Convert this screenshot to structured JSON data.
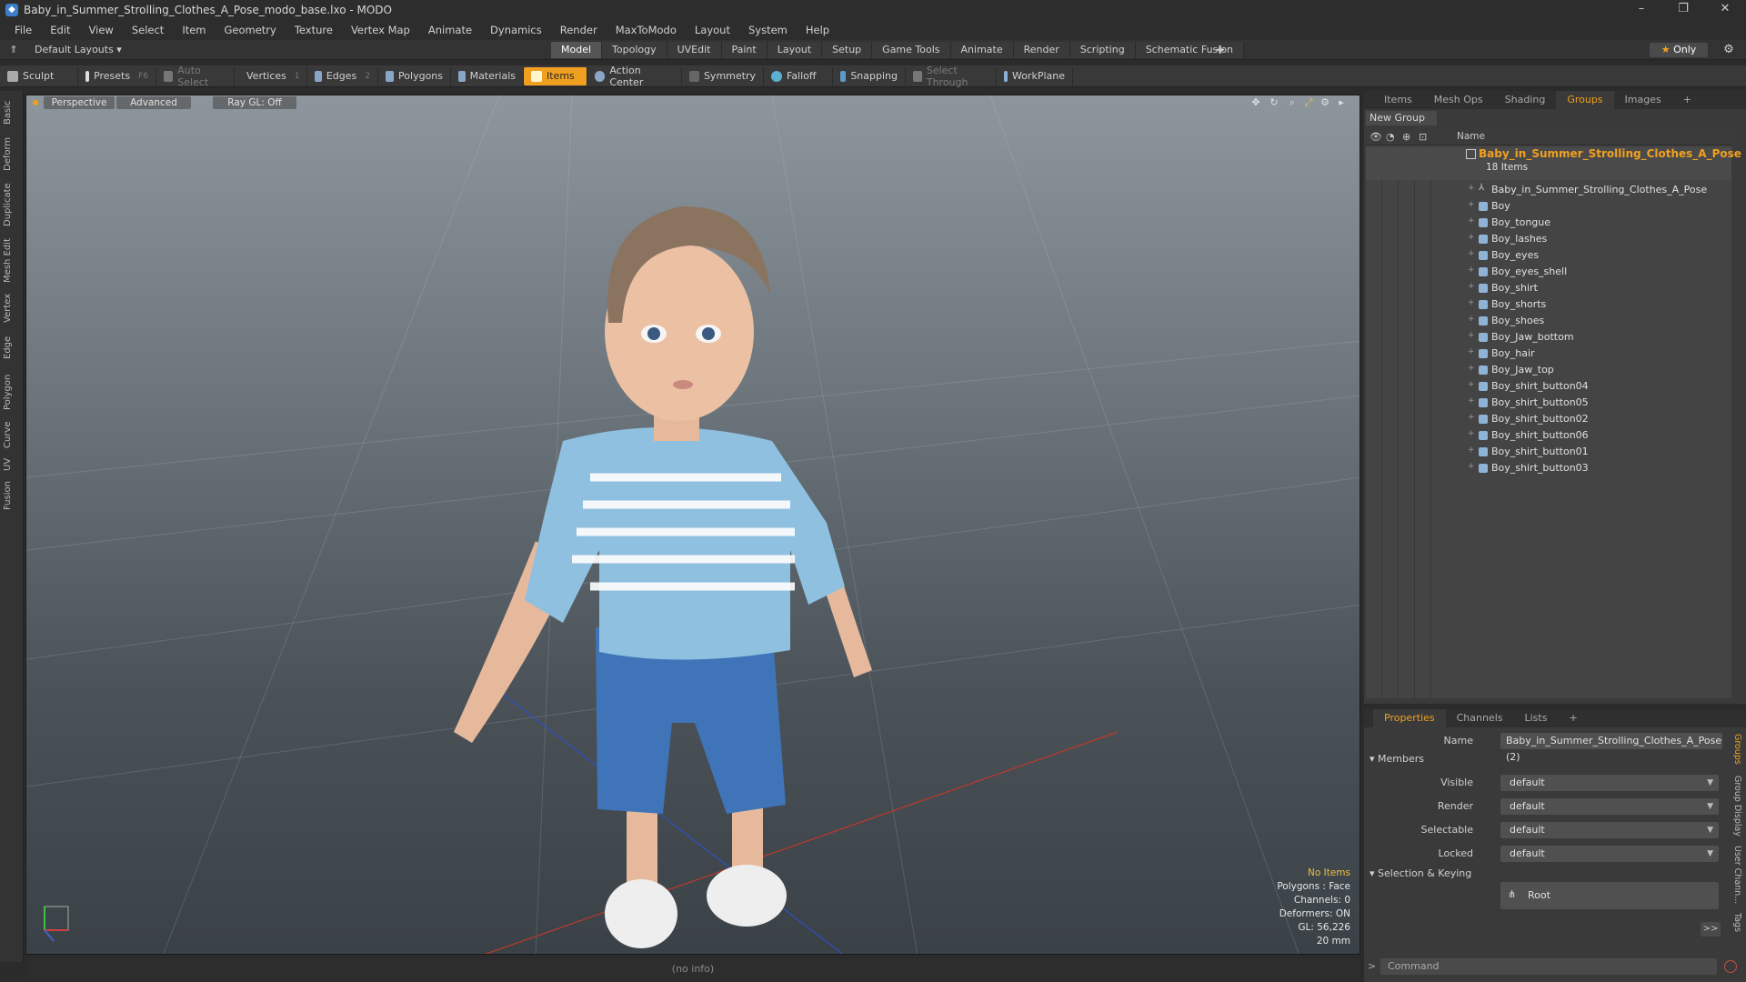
{
  "window": {
    "title": "Baby_in_Summer_Strolling_Clothes_A_Pose_modo_base.lxo - MODO",
    "minimize": "–",
    "restore": "❐",
    "close": "✕"
  },
  "menu": [
    "File",
    "Edit",
    "View",
    "Select",
    "Item",
    "Geometry",
    "Texture",
    "Vertex Map",
    "Animate",
    "Dynamics",
    "Render",
    "MaxToModo",
    "Layout",
    "System",
    "Help"
  ],
  "layoutbar": {
    "layouts_label": "Default Layouts ▾",
    "tabs": [
      "Model",
      "Topology",
      "UVEdit",
      "Paint",
      "Layout",
      "Setup",
      "Game Tools",
      "Animate",
      "Render",
      "Scripting",
      "Schematic Fusion"
    ],
    "active_tab": "Model",
    "add": "+",
    "only": "Only"
  },
  "toolbar": {
    "sculpt": "Sculpt",
    "presets": "Presets",
    "presets_key": "F6",
    "auto_select": "Auto Select",
    "vertices": "Vertices",
    "vertices_count": "1",
    "edges": "Edges",
    "edges_count": "2",
    "polygons": "Polygons",
    "materials": "Materials",
    "items": "Items",
    "action_center": "Action Center",
    "symmetry": "Symmetry",
    "falloff": "Falloff",
    "snapping": "Snapping",
    "select_through": "Select Through",
    "workplane": "WorkPlane"
  },
  "lefttabs": [
    "Basic",
    "Deform",
    "Duplicate",
    "Mesh Edit",
    "Vertex",
    "Edge",
    "Polygon",
    "Curve",
    "UV",
    "Fusion"
  ],
  "viewport": {
    "perspective": "Perspective",
    "advanced": "Advanced",
    "raygl": "Ray GL: Off",
    "hud": {
      "no_items": "No Items",
      "polygons": "Polygons : Face",
      "channels": "Channels: 0",
      "deformers": "Deformers: ON",
      "gl": "GL: 56,226",
      "scale": "20 mm"
    },
    "status": "(no info)"
  },
  "groups_panel": {
    "tabs": [
      "Items",
      "Mesh Ops",
      "Shading",
      "Groups",
      "Images"
    ],
    "active_tab": "Groups",
    "add": "+",
    "new_group": "New Group",
    "name_header": "Name",
    "group_name": "Baby_in_Summer_Strolling_Clothes_A_Pose",
    "group_count": "18 Items",
    "items": [
      "Baby_in_Summer_Strolling_Clothes_A_Pose",
      "Boy",
      "Boy_tongue",
      "Boy_lashes",
      "Boy_eyes",
      "Boy_eyes_shell",
      "Boy_shirt",
      "Boy_shorts",
      "Boy_shoes",
      "Boy_Jaw_bottom",
      "Boy_hair",
      "Boy_Jaw_top",
      "Boy_shirt_button04",
      "Boy_shirt_button05",
      "Boy_shirt_button02",
      "Boy_shirt_button06",
      "Boy_shirt_button01",
      "Boy_shirt_button03"
    ]
  },
  "properties_panel": {
    "tabs": [
      "Properties",
      "Channels",
      "Lists"
    ],
    "active_tab": "Properties",
    "add": "+",
    "name_label": "Name",
    "name_value": "Baby_in_Summer_Strolling_Clothes_A_Pose (2)",
    "members": "Members",
    "visible_label": "Visible",
    "visible_value": "default",
    "render_label": "Render",
    "render_value": "default",
    "selectable_label": "Selectable",
    "selectable_value": "default",
    "locked_label": "Locked",
    "locked_value": "default",
    "sel_keying": "Selection & Keying",
    "root": "Root",
    "more": ">>",
    "side_tabs": [
      "Groups",
      "Group Display",
      "User Chann...",
      "Tags"
    ],
    "command_placeholder": "Command"
  },
  "colors": {
    "accent": "#f0a020",
    "viewport_top": "#8d969d",
    "viewport_bottom": "#3a4147"
  }
}
